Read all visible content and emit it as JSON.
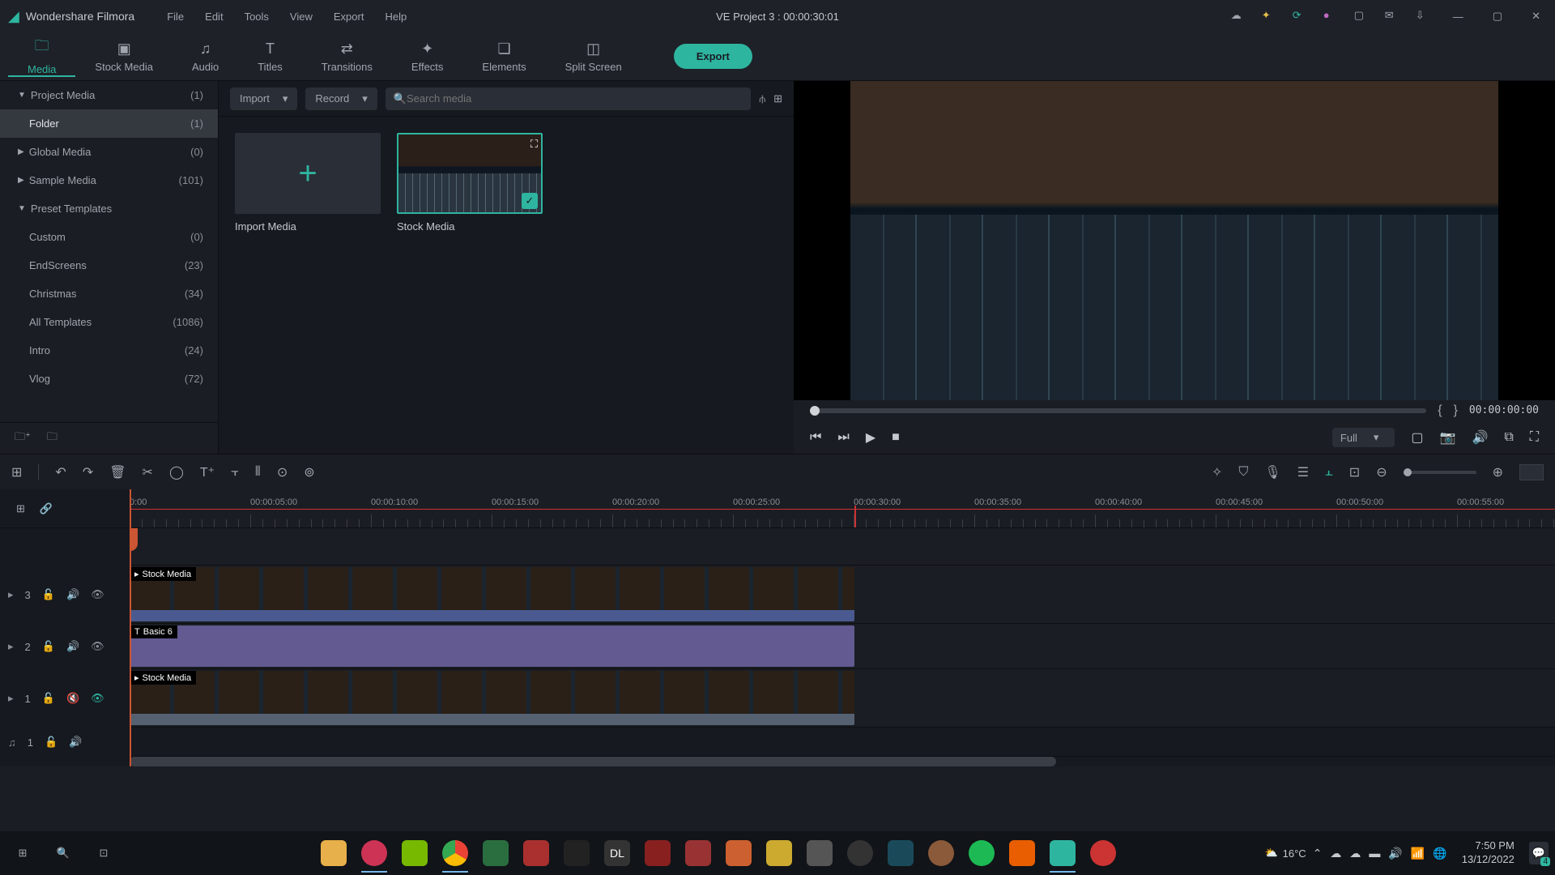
{
  "app": {
    "name": "Wondershare Filmora"
  },
  "menu": {
    "file": "File",
    "edit": "Edit",
    "tools": "Tools",
    "view": "View",
    "export": "Export",
    "help": "Help"
  },
  "project": {
    "title": "VE Project 3 : 00:00:30:01"
  },
  "tabs": {
    "media": "Media",
    "stock": "Stock Media",
    "audio": "Audio",
    "titles": "Titles",
    "transitions": "Transitions",
    "effects": "Effects",
    "elements": "Elements",
    "split": "Split Screen",
    "export_btn": "Export"
  },
  "sidebar": {
    "items": [
      {
        "label": "Project Media",
        "count": "(1)",
        "parent": true,
        "expanded": true
      },
      {
        "label": "Folder",
        "count": "(1)",
        "active": true
      },
      {
        "label": "Global Media",
        "count": "(0)",
        "parent": true,
        "expanded": false
      },
      {
        "label": "Sample Media",
        "count": "(101)",
        "parent": true,
        "expanded": false
      },
      {
        "label": "Preset Templates",
        "count": "",
        "parent": true,
        "expanded": true
      },
      {
        "label": "Custom",
        "count": "(0)"
      },
      {
        "label": "EndScreens",
        "count": "(23)"
      },
      {
        "label": "Christmas",
        "count": "(34)"
      },
      {
        "label": "All Templates",
        "count": "(1086)"
      },
      {
        "label": "Intro",
        "count": "(24)"
      },
      {
        "label": "Vlog",
        "count": "(72)"
      }
    ]
  },
  "media": {
    "import": "Import",
    "record": "Record",
    "search_placeholder": "Search media",
    "cards": [
      {
        "caption": "Import Media",
        "kind": "add"
      },
      {
        "caption": "Stock Media",
        "kind": "selected"
      }
    ]
  },
  "preview": {
    "time": "00:00:00:00",
    "quality": "Full"
  },
  "timeline": {
    "ticks": [
      "0:00",
      "00:00:05:00",
      "00:00:10:00",
      "00:00:15:00",
      "00:00:20:00",
      "00:00:25:00",
      "00:00:30:00",
      "00:00:35:00",
      "00:00:40:00",
      "00:00:45:00",
      "00:00:50:00",
      "00:00:55:00"
    ],
    "tracks": [
      {
        "id": "3",
        "type": "video",
        "clip": "Stock Media"
      },
      {
        "id": "2",
        "type": "title",
        "clip": "Basic 6"
      },
      {
        "id": "1",
        "type": "video",
        "clip": "Stock Media",
        "muted": true
      },
      {
        "id": "1",
        "type": "audio"
      }
    ]
  },
  "taskbar": {
    "weather": "16°C",
    "time": "7:50 PM",
    "date": "13/12/2022",
    "notif_count": "4"
  }
}
